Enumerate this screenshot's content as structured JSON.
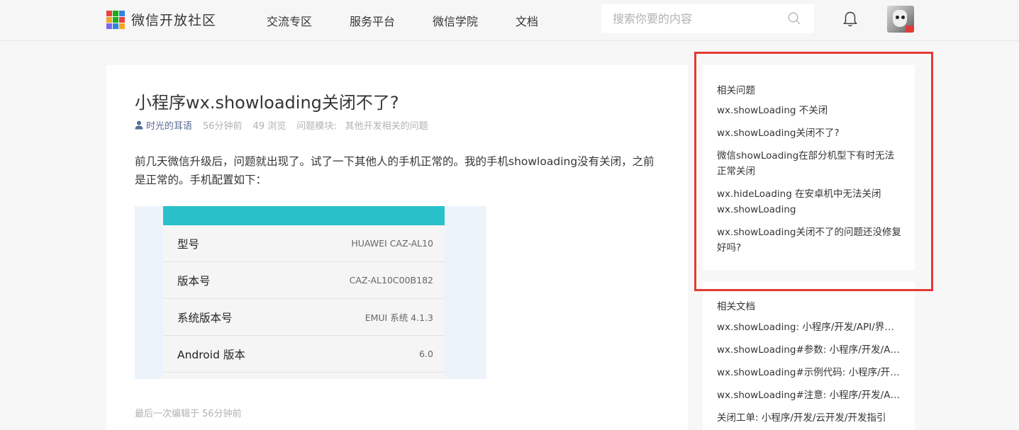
{
  "header": {
    "logo_text": "微信开放社区",
    "nav": [
      "交流专区",
      "服务平台",
      "微信学院",
      "文档"
    ],
    "search_placeholder": "搜索你要的内容",
    "logo_colors": [
      "#e64340",
      "#1aad19",
      "#2e86de",
      "#f5a623",
      "#1aad19",
      "#e64340",
      "#7b68ee",
      "#2e86de",
      "#f5a623"
    ]
  },
  "question": {
    "title": "小程序wx.showloading关闭不了?",
    "author": "时光的耳语",
    "time": "56分钟前",
    "views": "49 浏览",
    "module_label": "问题模块:",
    "module_value": "其他开发相关的问题",
    "body": "前几天微信升级后，问题就出现了。试了一下其他人的手机正常的。我的手机showloading没有关闭，之前是正常的。手机配置如下：",
    "specs": [
      {
        "key": "型号",
        "value": "HUAWEI CAZ-AL10"
      },
      {
        "key": "版本号",
        "value": "CAZ-AL10C00B182"
      },
      {
        "key": "系统版本号",
        "value": "EMUI 系统 4.1.3"
      },
      {
        "key": "Android 版本",
        "value": "6.0"
      }
    ],
    "edited": "最后一次编辑于  56分钟前"
  },
  "sidebar": {
    "related_title": "相关问题",
    "related": [
      "wx.showLoading 不关闭",
      "wx.showLoading关闭不了?",
      "微信showLoading在部分机型下有时无法正常关闭",
      "wx.hideLoading 在安卓机中无法关闭wx.showLoading",
      "wx.showLoading关闭不了的问题还没修复好吗?"
    ],
    "docs_title": "相关文档",
    "docs": [
      "wx.showLoading: 小程序/开发/API/界面/交互",
      "wx.showLoading#参数: 小程序/开发/API/界面",
      "wx.showLoading#示例代码: 小程序/开发/API",
      "wx.showLoading#注意: 小程序/开发/API/界面",
      "关闭工单: 小程序/开发/云开发/开发指引"
    ]
  },
  "colors": {
    "highlight": "#e53935",
    "link": "#576b95",
    "teal_bar": "#29c1c9"
  }
}
